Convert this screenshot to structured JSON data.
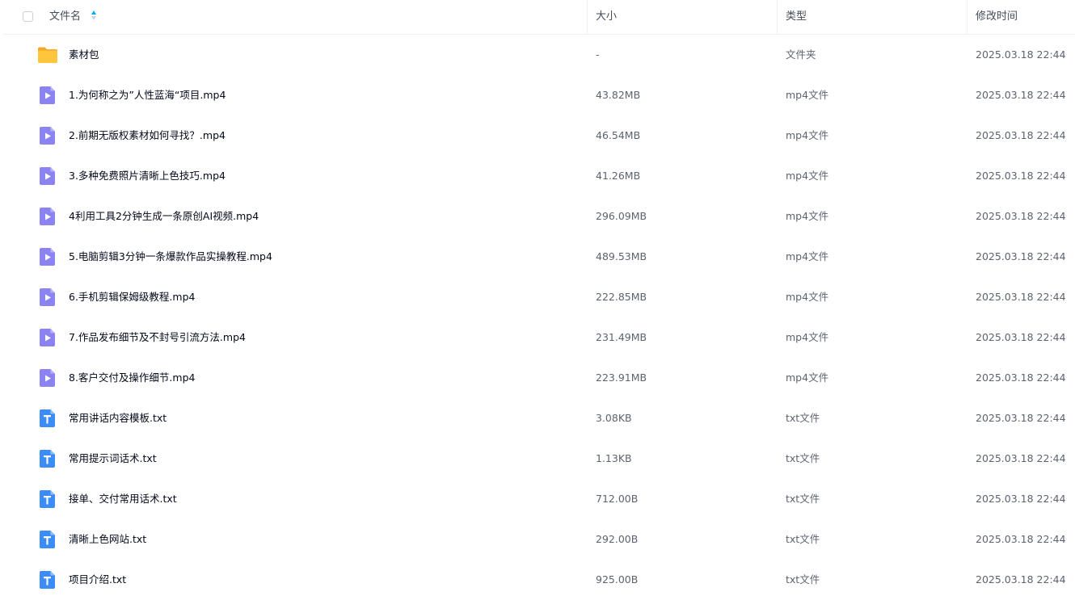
{
  "header": {
    "name": "文件名",
    "size": "大小",
    "type": "类型",
    "modified": "修改时间",
    "sort_icon": "sort-ascending-icon"
  },
  "colors": {
    "folder": "#ffc53d",
    "video": "#8c83f2",
    "text_file": "#3b8cf7",
    "sort_active": "#06a7ff"
  },
  "files": [
    {
      "icon": "folder-icon",
      "name": "素材包",
      "size": "-",
      "type": "文件夹",
      "modified": "2025.03.18 22:44"
    },
    {
      "icon": "video-file-icon",
      "name": "1.为何称之为”人性蓝海“项目.mp4",
      "size": "43.82MB",
      "type": "mp4文件",
      "modified": "2025.03.18 22:44"
    },
    {
      "icon": "video-file-icon",
      "name": "2.前期无版权素材如何寻找？.mp4",
      "size": "46.54MB",
      "type": "mp4文件",
      "modified": "2025.03.18 22:44"
    },
    {
      "icon": "video-file-icon",
      "name": "3.多种免费照片清晰上色技巧.mp4",
      "size": "41.26MB",
      "type": "mp4文件",
      "modified": "2025.03.18 22:44"
    },
    {
      "icon": "video-file-icon",
      "name": "4利用工具2分钟生成一条原创AI视频.mp4",
      "size": "296.09MB",
      "type": "mp4文件",
      "modified": "2025.03.18 22:44"
    },
    {
      "icon": "video-file-icon",
      "name": "5.电脑剪辑3分钟一条爆款作品实操教程.mp4",
      "size": "489.53MB",
      "type": "mp4文件",
      "modified": "2025.03.18 22:44"
    },
    {
      "icon": "video-file-icon",
      "name": "6.手机剪辑保姆级教程.mp4",
      "size": "222.85MB",
      "type": "mp4文件",
      "modified": "2025.03.18 22:44"
    },
    {
      "icon": "video-file-icon",
      "name": "7.作品发布细节及不封号引流方法.mp4",
      "size": "231.49MB",
      "type": "mp4文件",
      "modified": "2025.03.18 22:44"
    },
    {
      "icon": "video-file-icon",
      "name": "8.客户交付及操作细节.mp4",
      "size": "223.91MB",
      "type": "mp4文件",
      "modified": "2025.03.18 22:44"
    },
    {
      "icon": "text-file-icon",
      "name": "常用讲话内容模板.txt",
      "size": "3.08KB",
      "type": "txt文件",
      "modified": "2025.03.18 22:44"
    },
    {
      "icon": "text-file-icon",
      "name": "常用提示词话术.txt",
      "size": "1.13KB",
      "type": "txt文件",
      "modified": "2025.03.18 22:44"
    },
    {
      "icon": "text-file-icon",
      "name": "接单、交付常用话术.txt",
      "size": "712.00B",
      "type": "txt文件",
      "modified": "2025.03.18 22:44"
    },
    {
      "icon": "text-file-icon",
      "name": "清晰上色网站.txt",
      "size": "292.00B",
      "type": "txt文件",
      "modified": "2025.03.18 22:44"
    },
    {
      "icon": "text-file-icon",
      "name": "项目介绍.txt",
      "size": "925.00B",
      "type": "txt文件",
      "modified": "2025.03.18 22:44"
    }
  ]
}
